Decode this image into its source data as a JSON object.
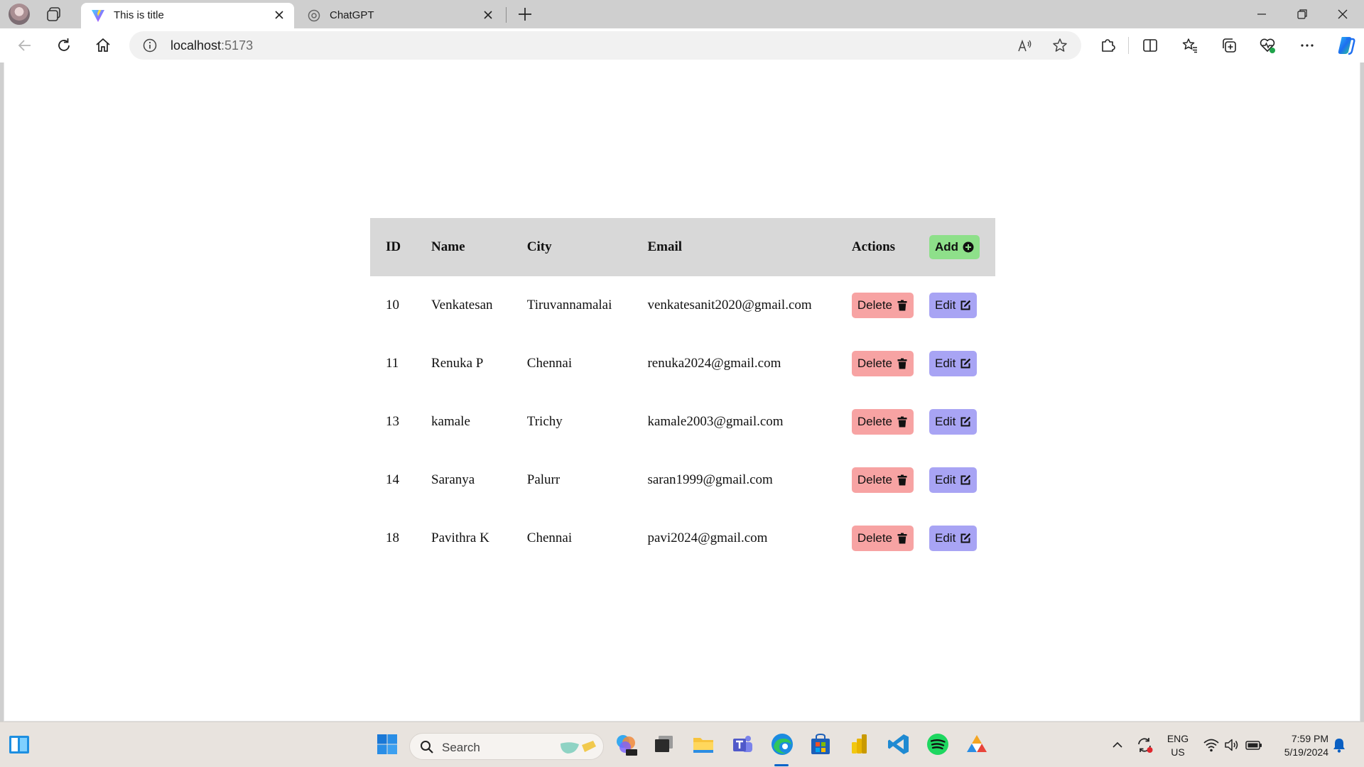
{
  "browser": {
    "tabs": [
      {
        "title": "This is title",
        "active": true,
        "favicon": "vite-logo-icon"
      },
      {
        "title": "ChatGPT",
        "active": false,
        "favicon": "chatgpt-icon"
      }
    ],
    "address": {
      "host": "localhost",
      "port": ":5173"
    }
  },
  "table": {
    "headers": {
      "id": "ID",
      "name": "Name",
      "city": "City",
      "email": "Email",
      "actions": "Actions"
    },
    "add_label": "Add",
    "delete_label": "Delete",
    "edit_label": "Edit",
    "rows": [
      {
        "id": "10",
        "name": "Venkatesan",
        "city": "Tiruvannamalai",
        "email": "venkatesanit2020@gmail.com"
      },
      {
        "id": "11",
        "name": "Renuka P",
        "city": "Chennai",
        "email": "renuka2024@gmail.com"
      },
      {
        "id": "13",
        "name": "kamale",
        "city": "Trichy",
        "email": "kamale2003@gmail.com"
      },
      {
        "id": "14",
        "name": "Saranya",
        "city": "Palurr",
        "email": "saran1999@gmail.com"
      },
      {
        "id": "18",
        "name": "Pavithra K",
        "city": "Chennai",
        "email": "pavi2024@gmail.com"
      }
    ]
  },
  "colors": {
    "add": "#8ee08a",
    "delete": "#f7a3a3",
    "edit": "#a8a4f4",
    "header_row": "#d8d8d8"
  },
  "taskbar": {
    "search_placeholder": "Search",
    "language": "ENG",
    "region": "US",
    "time": "7:59 PM",
    "date": "5/19/2024"
  }
}
